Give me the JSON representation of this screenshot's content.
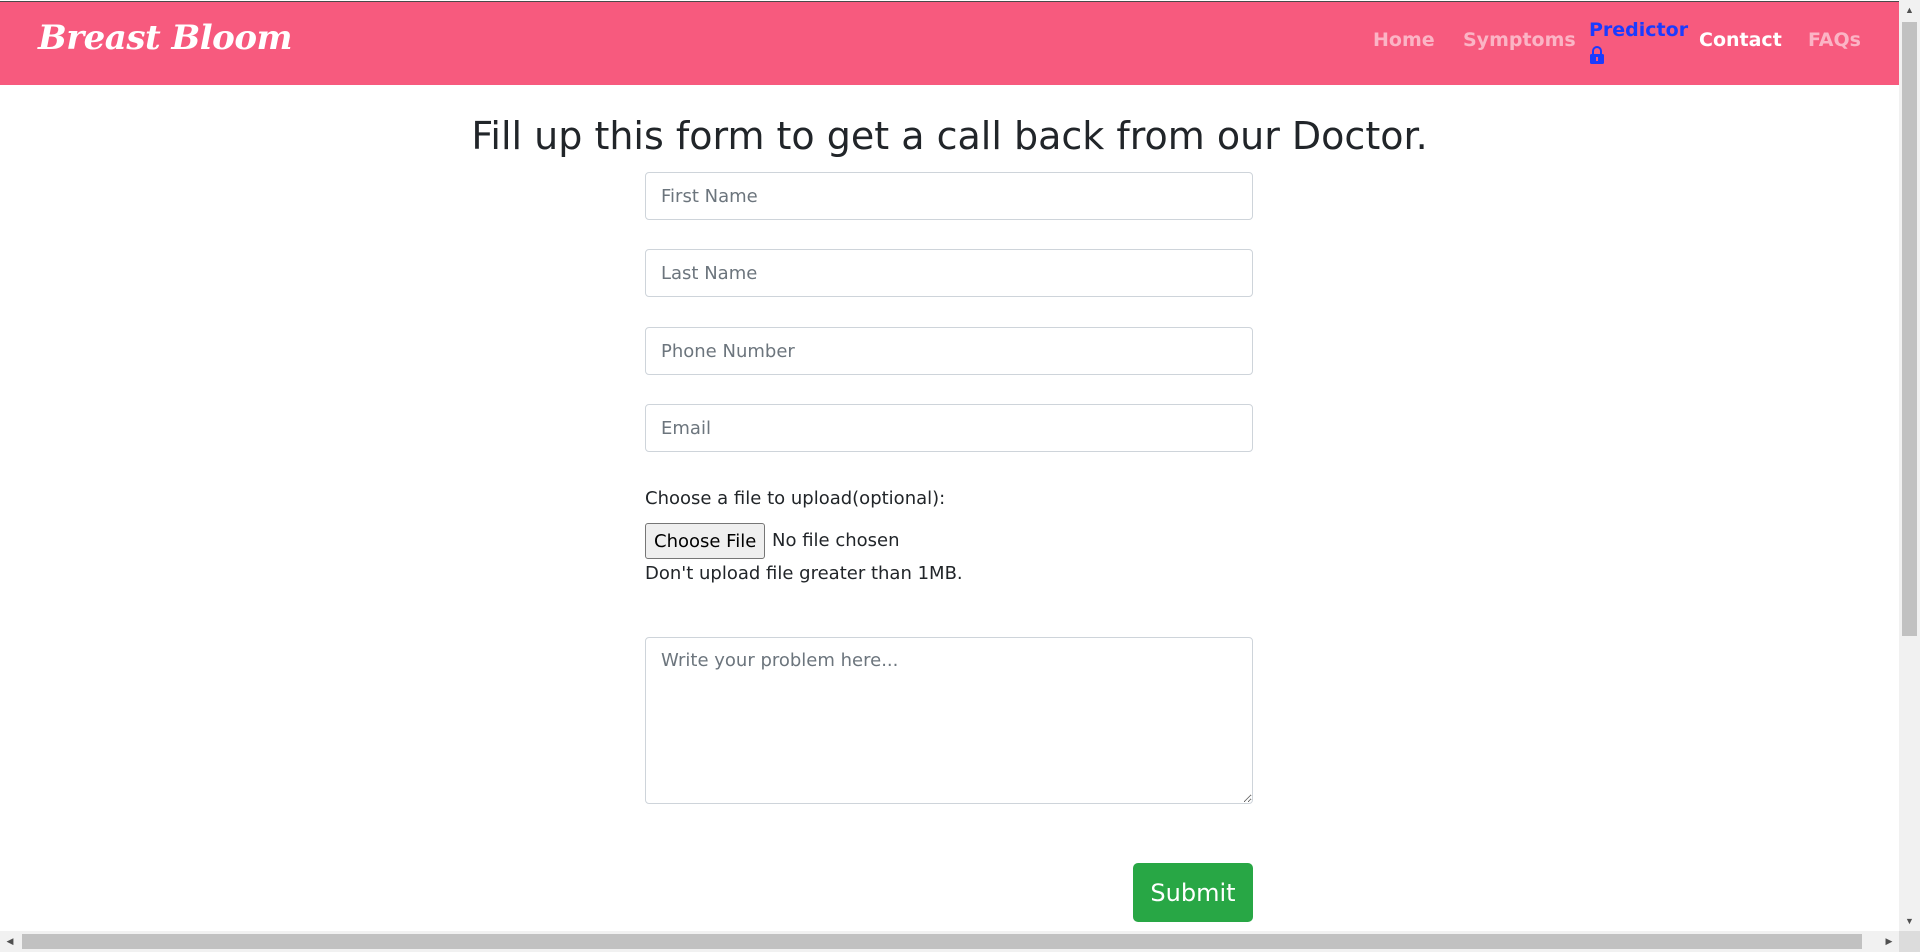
{
  "navbar": {
    "brand": "Breast Bloom",
    "links": {
      "home": "Home",
      "symptoms": "Symptoms",
      "predictor": "Predictor",
      "contact": "Contact",
      "faqs": "FAQs"
    },
    "predictor_icon": "lock-icon",
    "colors": {
      "background": "#f75a7e",
      "active": "#ffffff",
      "inactive": "rgba(255,255,255,0.55)",
      "predictor": "#1b3bff"
    }
  },
  "form": {
    "title": "Fill up this form to get a call back from our Doctor.",
    "first_name_placeholder": "First Name",
    "last_name_placeholder": "Last Name",
    "phone_placeholder": "Phone Number",
    "email_placeholder": "Email",
    "upload_label": "Choose a file to upload(optional):",
    "choose_file_label": "Choose File",
    "no_file_text": "No file chosen",
    "upload_hint": "Don't upload file greater than 1MB.",
    "problem_placeholder": "Write your problem here...",
    "submit_label": "Submit",
    "submit_color": "#28a745"
  },
  "scrollbars": {
    "up_arrow": "▲",
    "down_arrow": "▼",
    "left_arrow": "◀",
    "right_arrow": "▶"
  }
}
